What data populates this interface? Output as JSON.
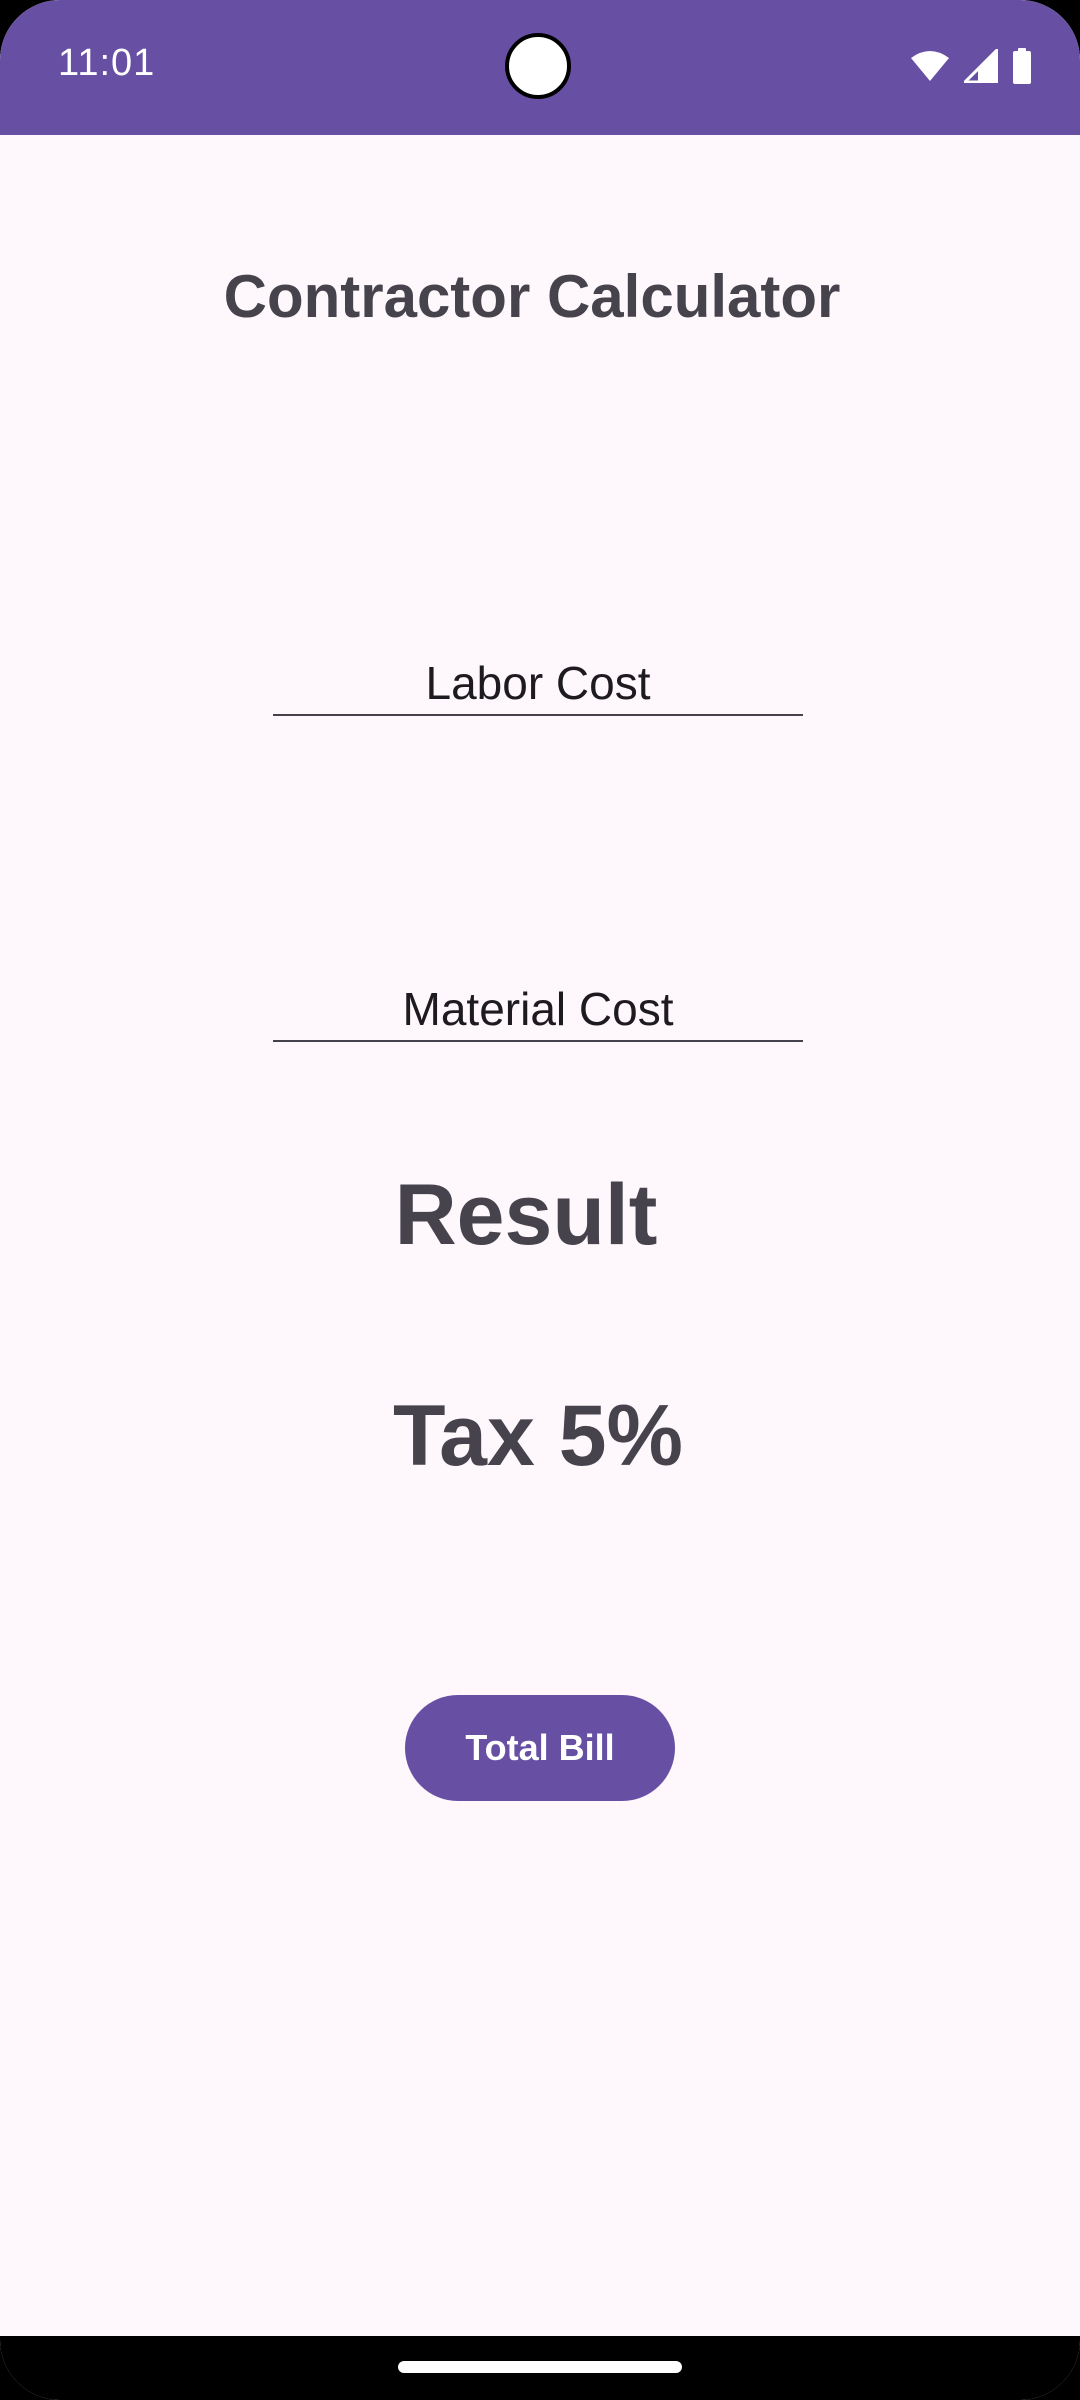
{
  "status_bar": {
    "time": "11:01",
    "icons": [
      "wifi-icon",
      "cellular-signal-icon",
      "battery-icon"
    ],
    "color": "#6750A4"
  },
  "app": {
    "title": "Contractor Calculator"
  },
  "form": {
    "labor_cost": {
      "placeholder": "Labor Cost",
      "value": ""
    },
    "material_cost": {
      "placeholder": "Material Cost",
      "value": ""
    }
  },
  "output": {
    "result_label": "Result",
    "tax_label": "Tax 5%"
  },
  "actions": {
    "total_bill_label": "Total Bill"
  },
  "colors": {
    "accent": "#6750A4",
    "background": "#FEF7FC",
    "text_dark": "#46434D"
  }
}
